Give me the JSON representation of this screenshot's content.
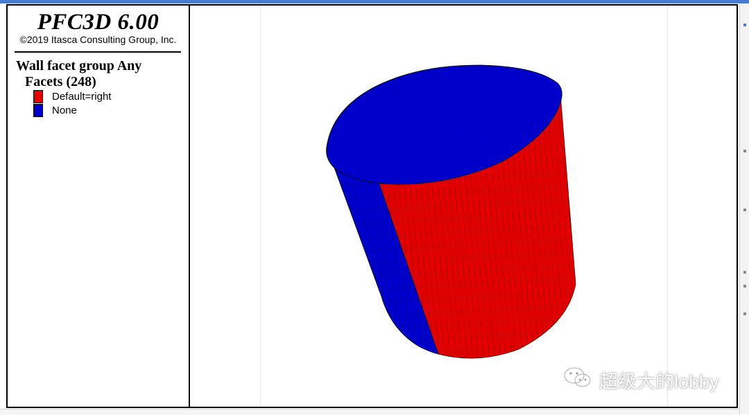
{
  "legend": {
    "app_title": "PFC3D 6.00",
    "copyright": "©2019 Itasca Consulting Group, Inc.",
    "heading": "Wall facet group Any",
    "subheading": "Facets (248)",
    "items": [
      {
        "label": "Default=right",
        "color": "#e00000"
      },
      {
        "label": "None",
        "color": "#0000cc"
      }
    ]
  },
  "plot": {
    "object": "cylinder wall",
    "colors": {
      "group_default_right": "#e00000",
      "group_none": "#0000cc"
    }
  },
  "watermark": {
    "icon": "wechat-icon",
    "text": "超级大的lobby"
  }
}
